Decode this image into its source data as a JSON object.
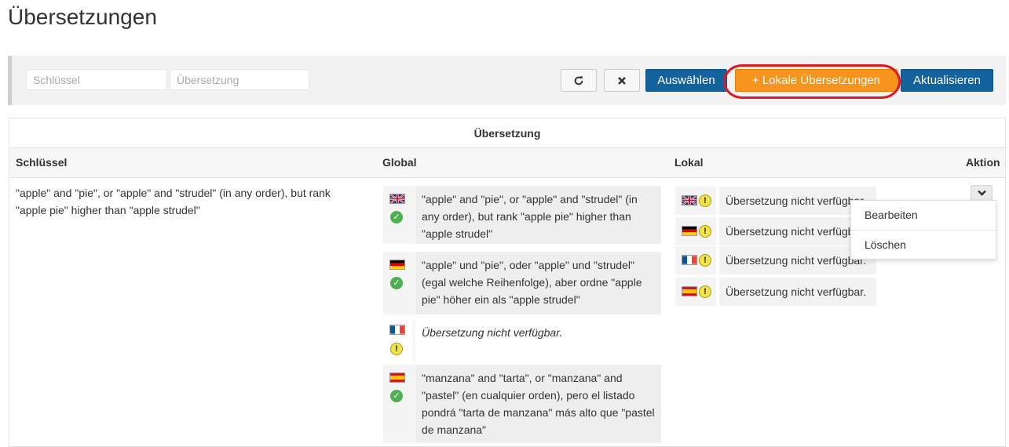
{
  "page": {
    "title": "Übersetzungen"
  },
  "toolbar": {
    "key_placeholder": "Schlüssel",
    "translation_placeholder": "Übersetzung",
    "refresh_icon": "refresh-icon",
    "clear_icon": "close-icon",
    "select_label": "Auswählen",
    "local_translations_label": "+ Lokale Übersetzungen",
    "update_label": "Aktualisieren"
  },
  "table": {
    "group_header": "Übersetzung",
    "columns": {
      "key": "Schlüssel",
      "global": "Global",
      "local": "Lokal",
      "action": "Aktion"
    },
    "row": {
      "key": "\"apple\" and \"pie\", or \"apple\" and \"strudel\" (in any order), but rank \"apple pie\" higher than \"apple strudel\"",
      "global": [
        {
          "flag": "uk-flag-icon",
          "status": "ok",
          "text": "\"apple\" and \"pie\", or \"apple\" and \"strudel\" (in any order), but rank \"apple pie\" higher than \"apple strudel\""
        },
        {
          "flag": "de-flag-icon",
          "status": "ok",
          "text": "\"apple\" und \"pie\", oder \"apple\" und \"strudel\" (egal welche Reihenfolge), aber ordne \"apple pie\" höher ein als \"apple strudel\""
        },
        {
          "flag": "fr-flag-icon",
          "status": "warning",
          "text": "Übersetzung nicht verfügbar."
        },
        {
          "flag": "es-flag-icon",
          "status": "ok",
          "text": "\"manzana\" and \"tarta\", or \"manzana\" and \"pastel\" (en cualquier orden), pero el listado pondrá \"tarta de manzana\" más alto que \"pastel de manzana\""
        }
      ],
      "local": [
        {
          "flag": "uk-flag-icon",
          "status": "warning",
          "text": "Übersetzung nicht verfügbar."
        },
        {
          "flag": "de-flag-icon",
          "status": "warning",
          "text": "Übersetzung nicht verfügbar."
        },
        {
          "flag": "fr-flag-icon",
          "status": "warning",
          "text": "Übersetzung nicht verfügbar."
        },
        {
          "flag": "es-flag-icon",
          "status": "warning",
          "text": "Übersetzung nicht verfügbar."
        }
      ]
    }
  },
  "action_menu": {
    "edit_label": "Bearbeiten",
    "delete_label": "Löschen"
  },
  "colors": {
    "primary": "#14629c",
    "accent_orange": "#f7941d",
    "highlight_ring": "#e3161f",
    "ok_green": "#4caf50",
    "warn_yellow": "#f2e34a"
  }
}
